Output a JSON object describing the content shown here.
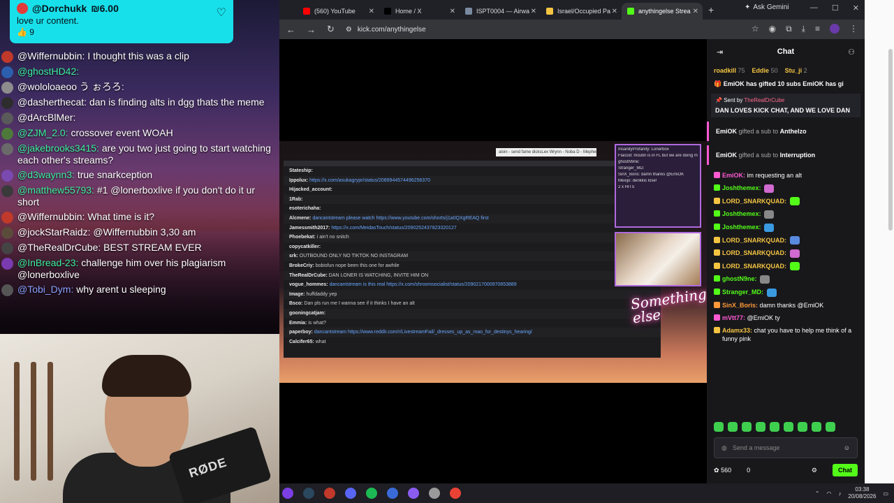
{
  "pinned": {
    "user": "@Dorchukk",
    "amount": "₪6.00",
    "message": "love ur content.",
    "likes": "9"
  },
  "stream_chat": [
    {
      "user": "@Wiffernubbin:",
      "text": "I thought this was a clip",
      "color": "#ffffff",
      "avatar": "#c0392b"
    },
    {
      "user": "@ghostHD42:",
      "text": "",
      "color": "#3ef0a0",
      "avatar": "#2b5fae"
    },
    {
      "user": "@wololoaeoo う ぉろろ:",
      "text": "",
      "color": "#ffffff",
      "avatar": "#8d8d8d"
    },
    {
      "user": "@dasherthecat:",
      "text": "dan is finding alts in dgg thats the meme",
      "color": "#ffffff",
      "avatar": "#2d2d2d"
    },
    {
      "user": "@dArcBlMer:",
      "text": "",
      "color": "#ffffff",
      "avatar": "#5a5a5a"
    },
    {
      "user": "@ZJM_2.0:",
      "text": "crossover event WOAH",
      "color": "#3ef0a0",
      "avatar": "#4d7a3a"
    },
    {
      "user": "@jakebrooks3415:",
      "text": "are you two just going to start watching each other's streams?",
      "color": "#3ef0a0",
      "avatar": "#6a6a6a"
    },
    {
      "user": "@d3waynn3:",
      "text": "true snarkception",
      "color": "#3ef0a0",
      "avatar": "#7a4ab0"
    },
    {
      "user": "@matthew55793:",
      "text": "#1 @lonerboxlive if you don't do it ur short",
      "color": "#3ef0a0",
      "avatar": "#3a3a3a"
    },
    {
      "user": "@Wiffernubbin:",
      "text": "What time is it?",
      "color": "#ffffff",
      "avatar": "#c0392b"
    },
    {
      "user": "@jockStarRaidz:",
      "text": "@Wiffernubbin 3,30 am",
      "color": "#ffffff",
      "avatar": "#5b4b3b"
    },
    {
      "user": "@TheRealDrCube:",
      "text": "BEST STREAM EVER",
      "color": "#ffffff",
      "avatar": "#444444"
    },
    {
      "user": "@InBread-23:",
      "text": "challenge him over his plagiarism @lonerboxlive",
      "color": "#3ef0a0",
      "avatar": "#7a3ab0"
    },
    {
      "user": "@Tobi_Dym:",
      "text": "why arent u sleeping",
      "color": "#8aa0ff",
      "avatar": "#555555"
    }
  ],
  "webcam": {
    "mic_brand": "RØDE"
  },
  "browser": {
    "tabs": [
      {
        "label": "(560) YouTube",
        "fav": "#ff0000"
      },
      {
        "label": "Home / X",
        "fav": "#000000"
      },
      {
        "label": "ISPT0004 — Airwa",
        "fav": "#7a8aa0"
      },
      {
        "label": "Israel/Occupied Pa",
        "fav": "#f5c542"
      },
      {
        "label": "anythingelse Strea",
        "fav": "#53fc18"
      }
    ],
    "gemini": "Ask Gemini",
    "url": "kick.com/anythingelse"
  },
  "stream_overlay": {
    "title_bar": "aloin - send fame dicksLex Wrynn - Noba D - Mephesto",
    "lines": [
      {
        "u": "Stateship:",
        "t": ""
      },
      {
        "u": "Ippolux:",
        "t": "https://x.com/asukagrypr/status/2089944574496256370"
      },
      {
        "u": "Hijacked_account:",
        "t": ""
      },
      {
        "u": "1Rab:",
        "t": ""
      },
      {
        "u": "esoterichaha:",
        "t": ""
      },
      {
        "u": "Alcmene:",
        "t": "dancantstream please watch https://www.youtube.com/shorts/j1a0QXgREAQ first"
      },
      {
        "u": "Jamessmith2017:",
        "t": "https://x.com/MeidasTouch/status/2090252437823320127"
      },
      {
        "u": "Phoebekat:",
        "t": "i ain't no snitch"
      },
      {
        "u": "copycatkiller:",
        "t": ""
      },
      {
        "u": "srk:",
        "t": "OUTBOUND ONLY  NO TIKTOK  NO INSTAGRAM"
      },
      {
        "u": "BrokeCriy:",
        "t": "bobisfun nope been this one for awhile"
      },
      {
        "u": "TheRealDrCube:",
        "t": "DAN LONER IS WATCHING, INVITE HIM ON"
      },
      {
        "u": "vogue_hommes:",
        "t": "dancantstream is this real https://x.com/shroomsocialist/status/2090217000970653889"
      },
      {
        "u": "Image:",
        "t": "huffdaddy yep"
      },
      {
        "u": "Bsco:",
        "t": "Dan pls run me I wanna see if it thinks I have an alt"
      },
      {
        "u": "gooningcatjam:",
        "t": ""
      },
      {
        "u": "Emmia:",
        "t": "is what?"
      },
      {
        "u": "paperboy:",
        "t": "dancantstream https://www.reddit.com/r/LivestreamFail/_dresses_up_as_mao_for_destinys_hearing/"
      },
      {
        "u": "Calcifer65:",
        "t": "what"
      }
    ],
    "side": [
      "InsanityProfanity: Lonerbox",
      "Flaccid: moutin is in FL but we are doing mil with lonerbox instead",
      "ghostN9ne:",
      "Stranger_MD:",
      "SinX_Boris: damn thanks @EmiOK",
      "Mexijo: denkkis lose!",
      "2 x HITS"
    ],
    "logo": "Something else"
  },
  "kick": {
    "header": "Chat",
    "leaders": [
      {
        "name": "roadkill",
        "n": "75"
      },
      {
        "name": "Eddie",
        "n": "50"
      },
      {
        "name": "Stu_ji",
        "n": "2"
      }
    ],
    "gift_banner": "EmiOK has gifted 10 subs  EmiOK has gi",
    "sent_by_label": "Sent by",
    "sent_by_user": "TheRealDrCube",
    "sent_by_msg": "DAN LOVES KICK CHAT, AND WE LOVE DAN",
    "gifts": [
      {
        "user": "EmiOK",
        "mid": "gifted a sub to",
        "to": "Anthelzo"
      },
      {
        "user": "EmiOK",
        "mid": "gifted a sub to",
        "to": "Interruption"
      }
    ],
    "messages": [
      {
        "u": "EmiOK:",
        "t": "im requesting an alt",
        "c": "#ff5ad2"
      },
      {
        "u": "Joshthemex:",
        "t": "",
        "c": "#53fc18"
      },
      {
        "u": "LORD_SNARKQUAD:",
        "t": "",
        "c": "#f5c542"
      },
      {
        "u": "Joshthemex:",
        "t": "",
        "c": "#53fc18"
      },
      {
        "u": "Joshthemex:",
        "t": "",
        "c": "#53fc18"
      },
      {
        "u": "LORD_SNARKQUAD:",
        "t": "",
        "c": "#f5c542"
      },
      {
        "u": "LORD_SNARKQUAD:",
        "t": "",
        "c": "#f5c542"
      },
      {
        "u": "LORD_SNARKQUAD:",
        "t": "",
        "c": "#f5c542"
      },
      {
        "u": "ghostN9ne:",
        "t": "",
        "c": "#53fc18"
      },
      {
        "u": "Stranger_MD:",
        "t": "",
        "c": "#53fc18"
      },
      {
        "u": "SinX_Boris:",
        "t": "damn thanks @EmiOK",
        "c": "#ff9a3a"
      },
      {
        "u": "mVtt77:",
        "t": "@EmiOK ty",
        "c": "#ff5ad2"
      },
      {
        "u": "Adamx33:",
        "t": "chat you have to help me think of a funny pink",
        "c": "#f5c542"
      }
    ],
    "input_placeholder": "Send a message",
    "viewers": "560",
    "count": "0",
    "chat_button": "Chat"
  },
  "taskbar": {
    "time": "03:38",
    "date": "20/08/2026"
  }
}
